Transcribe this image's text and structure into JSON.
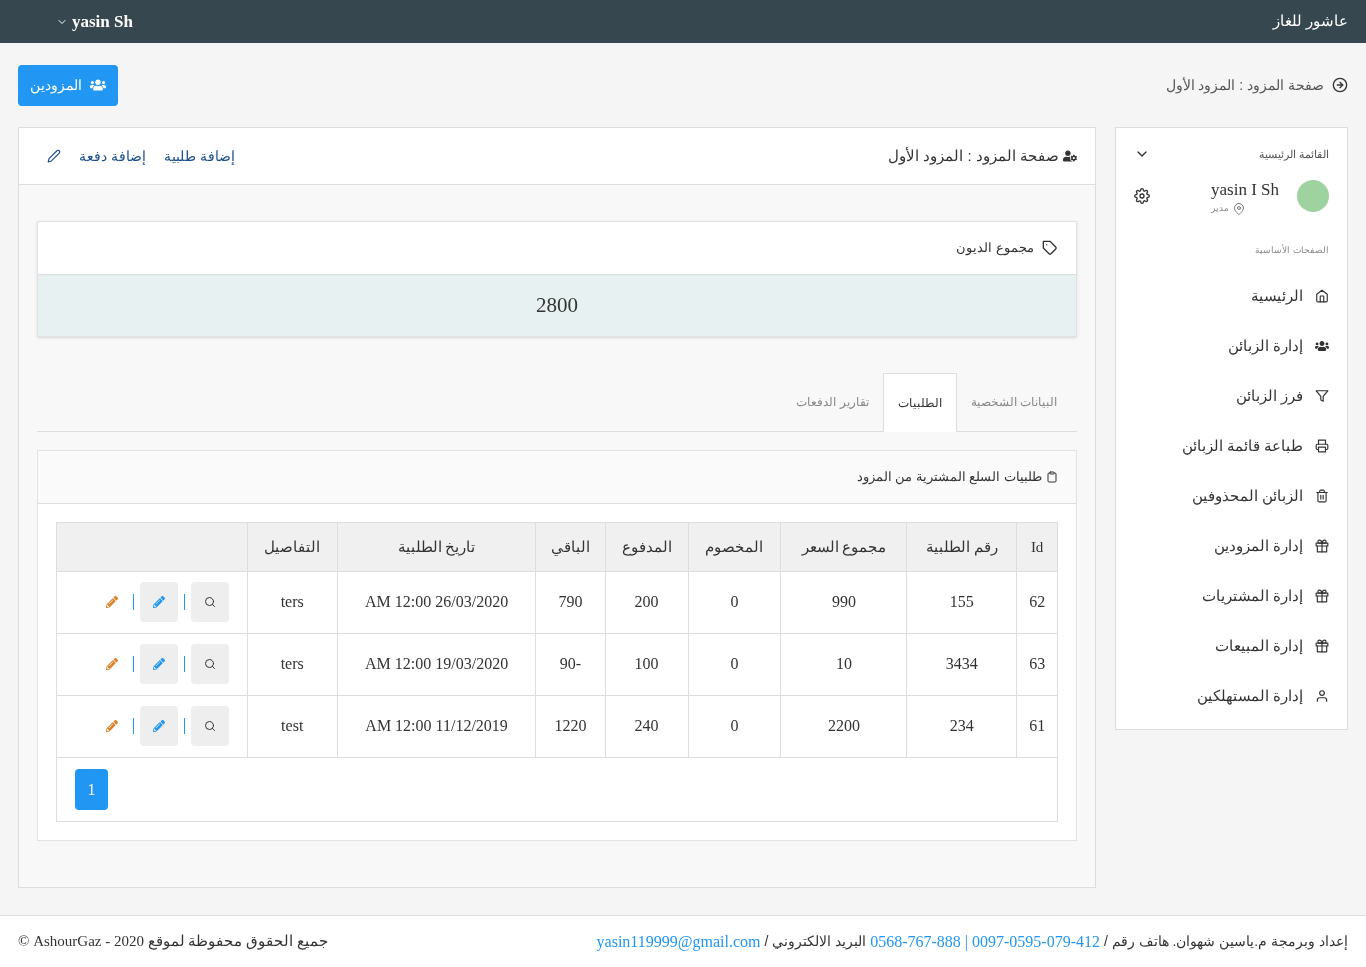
{
  "topbar": {
    "brand": "عاشور للغاز",
    "user": "yasin Sh"
  },
  "breadcrumb": "صفحة المزود : المزود الأول",
  "header_button": "المزودين",
  "sidebar": {
    "title": "القائمة الرئيسية",
    "user_name": "yasin I Sh",
    "role": "مدير",
    "section": "الصفحات الأساسية",
    "items": [
      {
        "label": "الرئيسية",
        "kind": "home"
      },
      {
        "label": "إدارة الزبائن",
        "kind": "users"
      },
      {
        "label": "فرز الزبائن",
        "kind": "filter"
      },
      {
        "label": "طباعة قائمة الزبائن",
        "kind": "print"
      },
      {
        "label": "الزبائن المحذوفين",
        "kind": "trash"
      },
      {
        "label": "إدارة المزودين",
        "kind": "gift"
      },
      {
        "label": "إدارة المشتريات",
        "kind": "gift"
      },
      {
        "label": "إدارة المبيعات",
        "kind": "gift"
      },
      {
        "label": "إدارة المستهلكين",
        "kind": "user"
      }
    ]
  },
  "panel": {
    "title": "صفحة المزود : المزود الأول",
    "links": [
      "إضافة طلبية",
      "إضافة دفعة"
    ]
  },
  "debt": {
    "title": "مجموع الديون",
    "value": "2800"
  },
  "tabs": [
    {
      "label": "البيانات الشخصية",
      "selected": false
    },
    {
      "label": "الطلبيات",
      "selected": true
    },
    {
      "label": "تقارير الدفعات",
      "selected": false
    }
  ],
  "orders": {
    "title": "طلبيات السلع المشترية من المزود",
    "columns": [
      "Id",
      "رقم الطلبية",
      "مجموع السعر",
      "المخصوم",
      "المدفوع",
      "الباقي",
      "تاريخ الطلبية",
      "التفاصيل"
    ],
    "rows": [
      [
        "62",
        "155",
        "990",
        "0",
        "200",
        "790",
        "AM 12:00 26/03/2020",
        "ters"
      ],
      [
        "63",
        "3434",
        "10",
        "0",
        "100",
        "90-",
        "AM 12:00 19/03/2020",
        "ters"
      ],
      [
        "61",
        "234",
        "2200",
        "0",
        "240",
        "1220",
        "AM 12:00 11/12/2019",
        "test"
      ]
    ],
    "pages": [
      {
        "label": "1",
        "selected": true
      }
    ]
  },
  "footer": {
    "credit": "إعداد وبرمجة م.ياسين شهوان. هاتف رقم /",
    "phone_1": "0097-0595-079-412",
    "separator": "|",
    "phone_2": "0568-767-888",
    "email_label": "البريد الالكتروني /",
    "email": "yasin119999@gmail.com",
    "copyright": "جميع الحقوق محفوظة لموقع AshourGaz - 2020 ©"
  }
}
